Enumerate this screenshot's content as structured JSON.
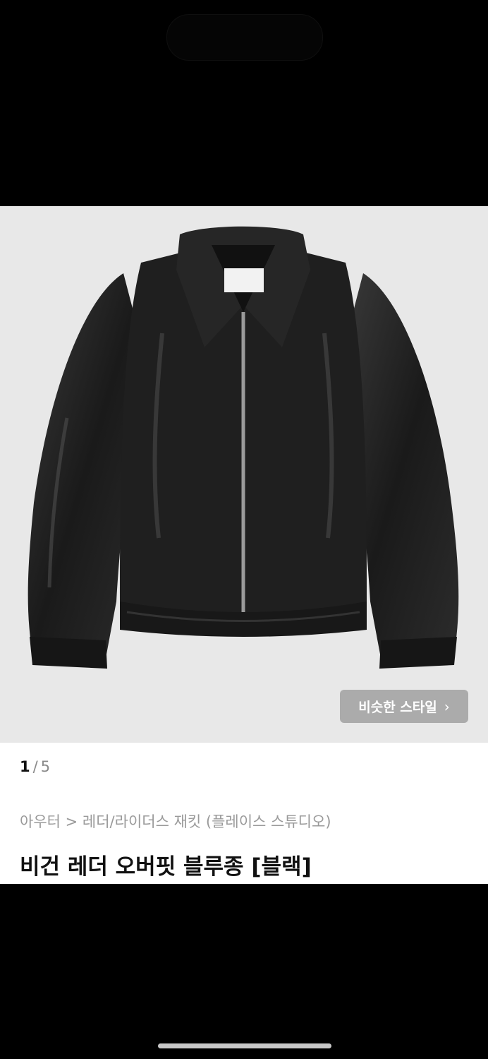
{
  "image_viewer": {
    "similar_style_label": "비슷한 스타일",
    "chevron_icon": "chevron-right-icon",
    "pager_current": "1",
    "pager_separator": "/",
    "pager_total": "5"
  },
  "product": {
    "breadcrumb": "아우터 > 레더/라이더스 재킷 (플레이스 스튜디오)",
    "title": "비건 레더 오버핏 블루종 [블랙]"
  },
  "colors": {
    "image_background": "#e8e8e8",
    "jacket": "#1c1c1c",
    "button_background": "#a0a0a0"
  }
}
